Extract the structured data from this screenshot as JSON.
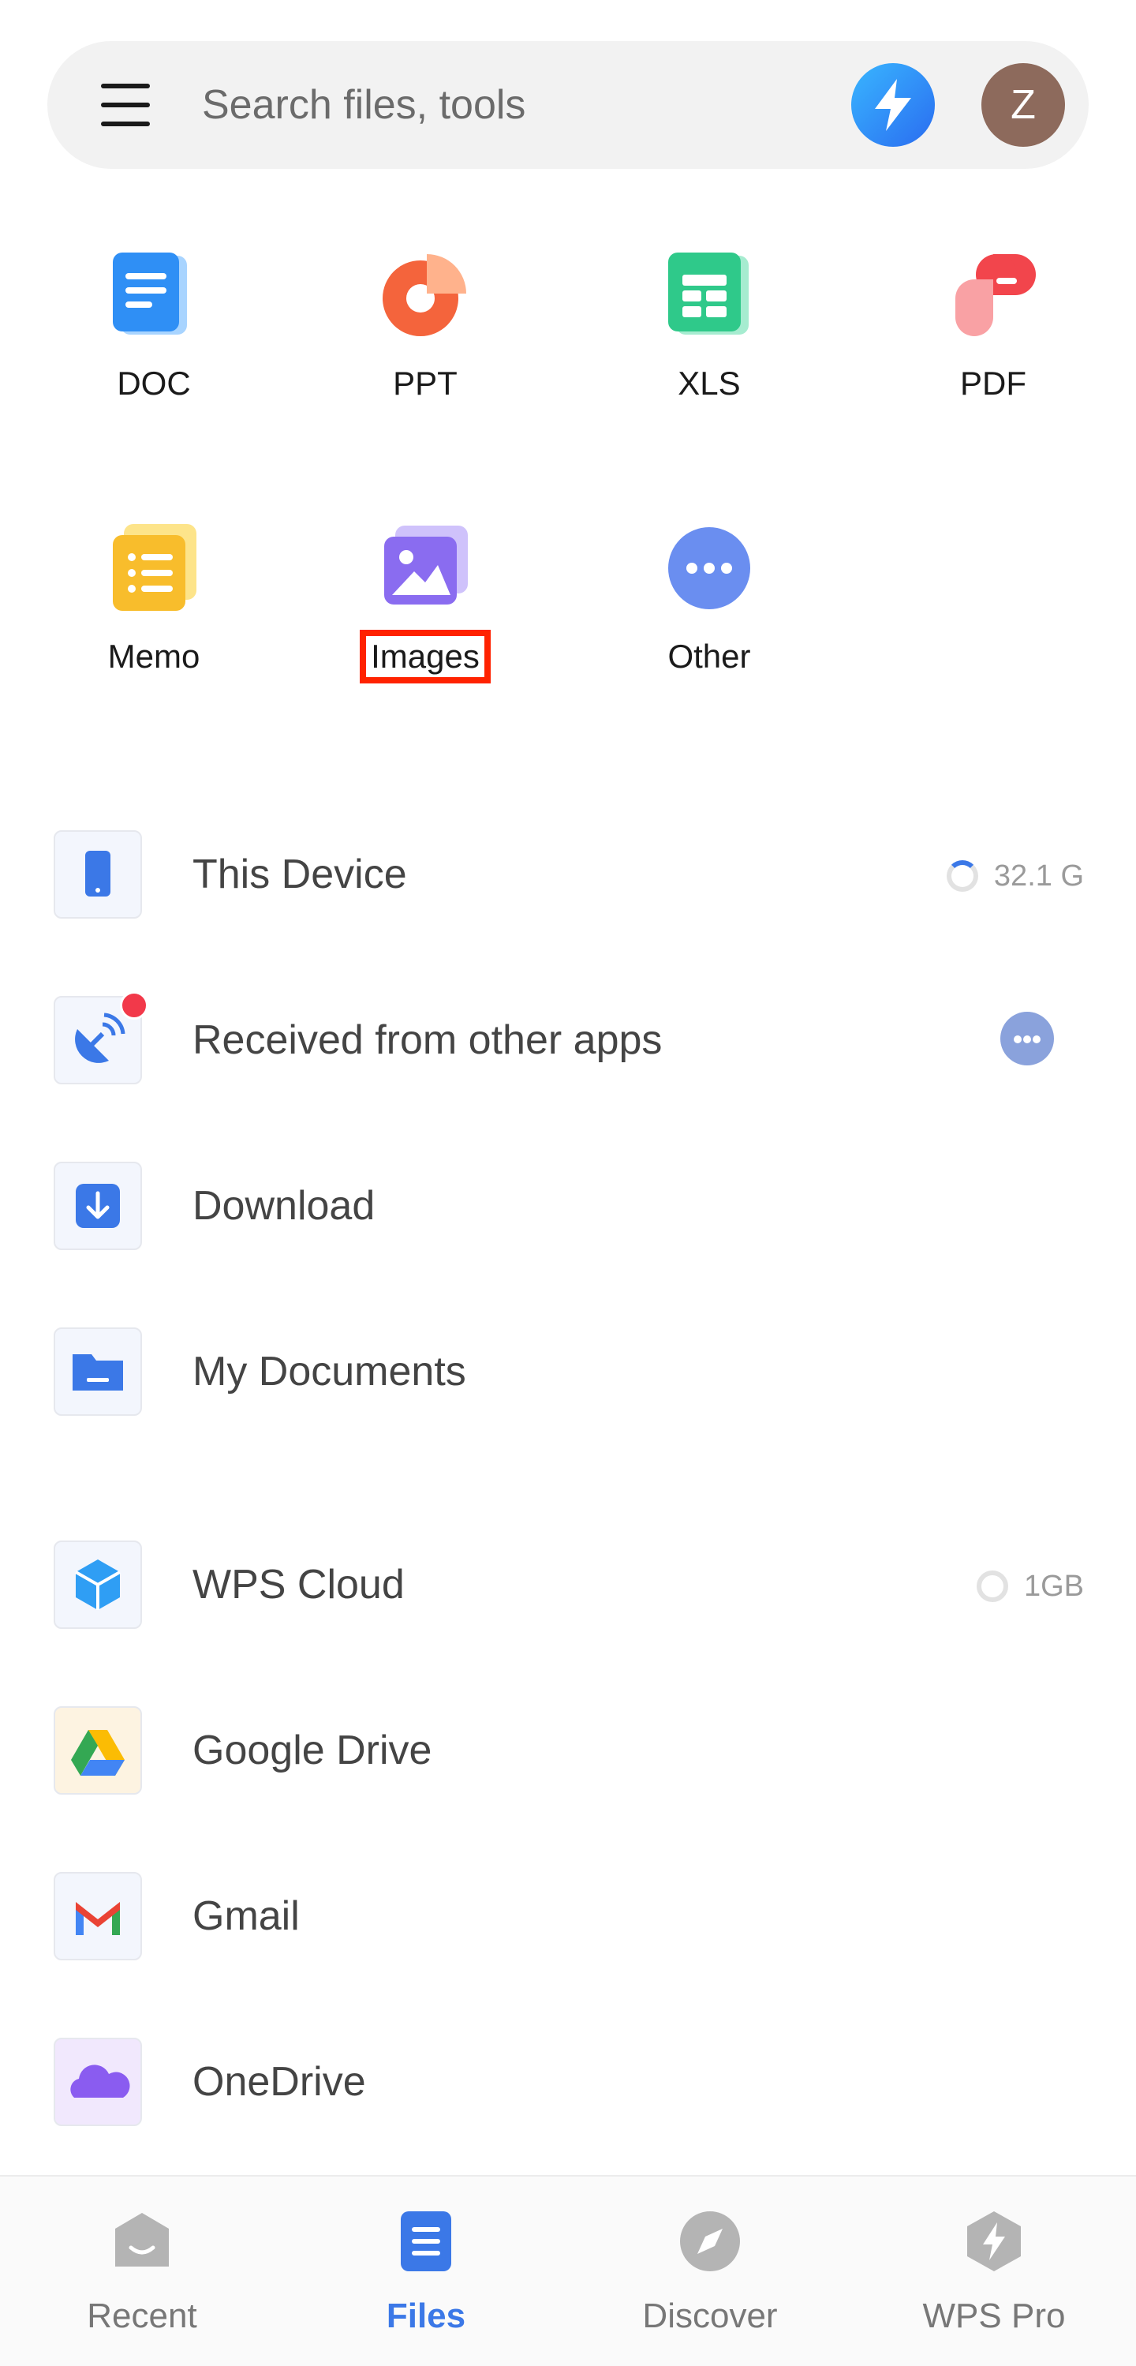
{
  "search": {
    "placeholder": "Search files, tools",
    "avatar_letter": "Z"
  },
  "categories": [
    {
      "label": "DOC",
      "icon": "doc-icon",
      "color": "#2f8ff5"
    },
    {
      "label": "PPT",
      "icon": "ppt-icon",
      "color": "#f4643c"
    },
    {
      "label": "XLS",
      "icon": "xls-icon",
      "color": "#2fc98a"
    },
    {
      "label": "PDF",
      "icon": "pdf-icon",
      "color": "#f2454c"
    },
    {
      "label": "Memo",
      "icon": "memo-icon",
      "color": "#f8bd2c"
    },
    {
      "label": "Images",
      "icon": "images-icon",
      "color": "#8a6cf0"
    },
    {
      "label": "Other",
      "icon": "other-icon",
      "color": "#6a8ef0"
    }
  ],
  "locations": [
    {
      "label": "This Device",
      "icon": "phone-icon",
      "meta": "32.1 G"
    },
    {
      "label": "Received from other apps",
      "icon": "satellite-icon"
    },
    {
      "label": "Download",
      "icon": "download-icon"
    },
    {
      "label": "My Documents",
      "icon": "folder-icon"
    }
  ],
  "cloud": [
    {
      "label": "WPS Cloud",
      "icon": "wps-cloud-icon",
      "meta": "1GB"
    },
    {
      "label": "Google Drive",
      "icon": "google-drive-icon"
    },
    {
      "label": "Gmail",
      "icon": "gmail-icon"
    },
    {
      "label": "OneDrive",
      "icon": "onedrive-icon"
    }
  ],
  "nav": {
    "recent": "Recent",
    "files": "Files",
    "discover": "Discover",
    "wps_pro": "WPS Pro",
    "active": "Files"
  },
  "colors": {
    "accent": "#3b78e7",
    "highlight": "#ff2200",
    "badge": "#f2394a"
  }
}
